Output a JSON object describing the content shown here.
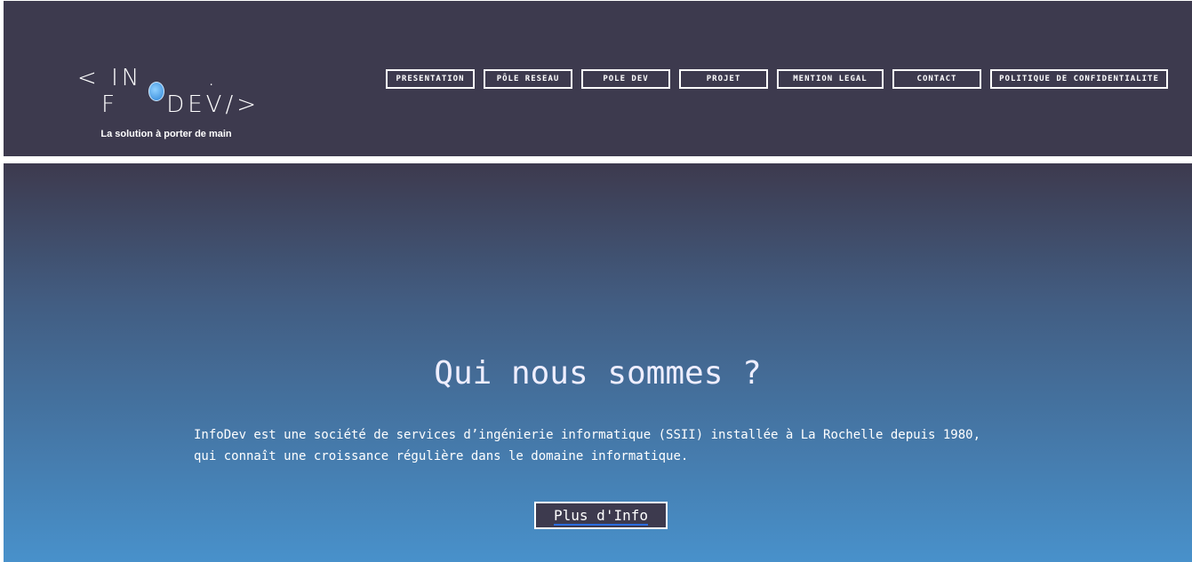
{
  "header": {
    "logo": {
      "text_left": "< IN F",
      "text_right": ". DEV/>",
      "tagline": "La solution à porter de main"
    },
    "nav": [
      "PRESENTATION",
      "PÔLE RESEAU",
      "POLE DEV",
      "PROJET",
      "MENTION LEGAL",
      "CONTACT",
      "POLITIQUE DE CONFIDENTIALITE"
    ]
  },
  "hero": {
    "title": "Qui nous sommes ?",
    "description": "InfoDev est une société de services d’ingénierie informatique (SSII) installée à La Rochelle depuis 1980, qui connaît une croissance régulière dans le domaine informatique.",
    "button": "Plus d'Info"
  }
}
